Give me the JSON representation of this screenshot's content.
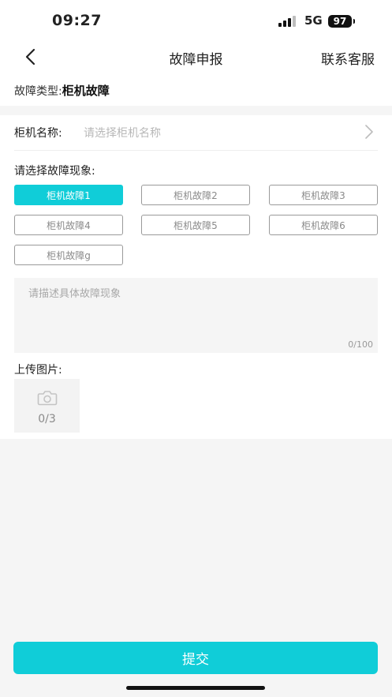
{
  "status_bar": {
    "time": "09:27",
    "network": "5G",
    "battery": "97"
  },
  "nav": {
    "title": "故障申报",
    "right_action": "联系客服"
  },
  "fault_type": {
    "label": "故障类型:",
    "value": "柜机故障"
  },
  "cabinet": {
    "label": "柜机名称:",
    "placeholder": "请选择柜机名称"
  },
  "symptoms": {
    "label": "请选择故障现象:",
    "options": [
      "柜机故障1",
      "柜机故障2",
      "柜机故障3",
      "柜机故障4",
      "柜机故障5",
      "柜机故障6",
      "柜机故障g"
    ],
    "selected": "柜机故障1"
  },
  "description": {
    "placeholder": "请描述具体故障现象",
    "counter": "0/100"
  },
  "upload": {
    "label": "上传图片:",
    "counter": "0/3",
    "icon": "camera-icon"
  },
  "submit": {
    "label": "提交"
  },
  "colors": {
    "accent": "#10cdd8",
    "page_bg": "#f5f5f5"
  }
}
